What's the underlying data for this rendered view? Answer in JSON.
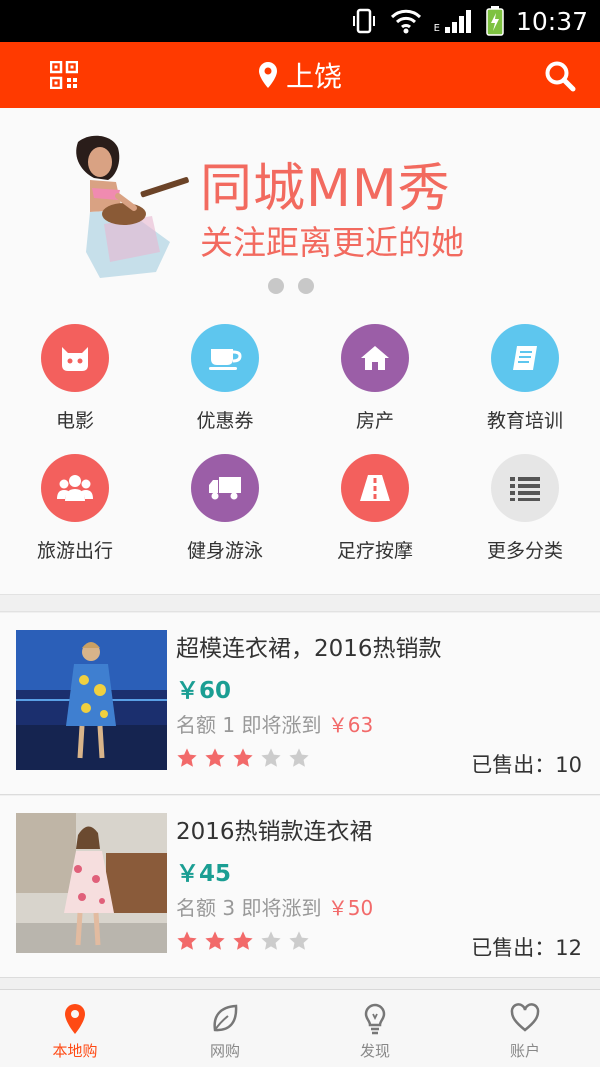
{
  "status_bar": {
    "time": "10:37",
    "network_label": "E",
    "icons": [
      "vibrate-icon",
      "wifi-icon",
      "signal-icon",
      "battery-charging-icon"
    ]
  },
  "header": {
    "city": "上饶",
    "left_icon": "qr-code-icon",
    "right_icon": "search-icon",
    "location_icon": "location-pin-icon"
  },
  "banner": {
    "title": "同城MM秀",
    "subtitle": "关注距离更近的她",
    "page_count": 2
  },
  "categories": [
    {
      "label": "电影",
      "icon": "movie-icon",
      "color": "#f3605d"
    },
    {
      "label": "优惠券",
      "icon": "coffee-cup-icon",
      "color": "#5ec6ee"
    },
    {
      "label": "房产",
      "icon": "house-icon",
      "color": "#9b5ea7"
    },
    {
      "label": "教育培训",
      "icon": "book-icon",
      "color": "#5ec6ee"
    },
    {
      "label": "旅游出行",
      "icon": "people-icon",
      "color": "#f3605d"
    },
    {
      "label": "健身游泳",
      "icon": "truck-icon",
      "color": "#9b5ea7"
    },
    {
      "label": "足疗按摩",
      "icon": "road-icon",
      "color": "#f3605d"
    },
    {
      "label": "更多分类",
      "icon": "list-icon",
      "color": "#e6e6e6"
    }
  ],
  "products": [
    {
      "title": "超模连衣裙，2016热销款",
      "price": "￥60",
      "quota_label": "名额",
      "quota": "1",
      "rise_label": "即将涨到",
      "rise_price": "￥63",
      "rating": 3,
      "rating_max": 5,
      "sold_label": "已售出：",
      "sold": "10"
    },
    {
      "title": "2016热销款连衣裙",
      "price": "￥45",
      "quota_label": "名额",
      "quota": "3",
      "rise_label": "即将涨到",
      "rise_price": "￥50",
      "rating": 3,
      "rating_max": 5,
      "sold_label": "已售出：",
      "sold": "12"
    }
  ],
  "bottom_nav": [
    {
      "label": "本地购",
      "icon": "location-pin-icon",
      "active": true
    },
    {
      "label": "网购",
      "icon": "leaf-icon",
      "active": false
    },
    {
      "label": "发现",
      "icon": "lightbulb-icon",
      "active": false
    },
    {
      "label": "账户",
      "icon": "heart-icon",
      "active": false
    }
  ],
  "colors": {
    "brand": "#ff3a00",
    "price": "#1a9e93",
    "rise": "#f26a6a",
    "star_on": "#f26a6a",
    "star_off": "#cccccc"
  }
}
